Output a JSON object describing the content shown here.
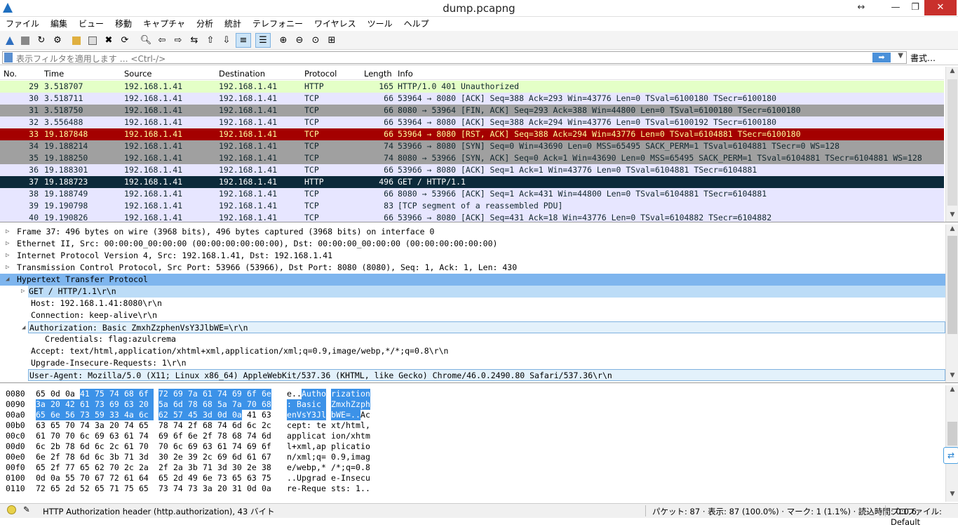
{
  "window": {
    "title": "dump.pcapng"
  },
  "menu": [
    "ファイル",
    "編集",
    "ビュー",
    "移動",
    "キャプチャ",
    "分析",
    "統計",
    "テレフォニー",
    "ワイヤレス",
    "ツール",
    "ヘルプ"
  ],
  "filter": {
    "placeholder": "表示フィルタを適用します … <Ctrl-/>",
    "format_label": "書式…"
  },
  "packet_list": {
    "columns": [
      "No.",
      "Time",
      "Source",
      "Destination",
      "Protocol",
      "Length",
      "Info"
    ],
    "rows": [
      {
        "no": "29",
        "time": "3.518707",
        "src": "192.168.1.41",
        "dst": "192.168.1.41",
        "proto": "HTTP",
        "len": "165",
        "info": "HTTP/1.0 401 Unauthorized",
        "bg": "#e4ffc7",
        "fg": "#12272e"
      },
      {
        "no": "30",
        "time": "3.518711",
        "src": "192.168.1.41",
        "dst": "192.168.1.41",
        "proto": "TCP",
        "len": "66",
        "info": "53964 → 8080 [ACK] Seq=388 Ack=293 Win=43776 Len=0 TSval=6100180 TSecr=6100180",
        "bg": "#e7e6ff",
        "fg": "#12272e"
      },
      {
        "no": "31",
        "time": "3.518750",
        "src": "192.168.1.41",
        "dst": "192.168.1.41",
        "proto": "TCP",
        "len": "66",
        "info": "8080 → 53964 [FIN, ACK] Seq=293 Ack=388 Win=44800 Len=0 TSval=6100180 TSecr=6100180",
        "bg": "#a0a0a0",
        "fg": "#12272e"
      },
      {
        "no": "32",
        "time": "3.556488",
        "src": "192.168.1.41",
        "dst": "192.168.1.41",
        "proto": "TCP",
        "len": "66",
        "info": "53964 → 8080 [ACK] Seq=388 Ack=294 Win=43776 Len=0 TSval=6100192 TSecr=6100180",
        "bg": "#e7e6ff",
        "fg": "#12272e"
      },
      {
        "no": "33",
        "time": "19.187848",
        "src": "192.168.1.41",
        "dst": "192.168.1.41",
        "proto": "TCP",
        "len": "66",
        "info": "53964 → 8080 [RST, ACK] Seq=388 Ack=294 Win=43776 Len=0 TSval=6104881 TSecr=6100180",
        "bg": "#a40000",
        "fg": "#fffc9c"
      },
      {
        "no": "34",
        "time": "19.188214",
        "src": "192.168.1.41",
        "dst": "192.168.1.41",
        "proto": "TCP",
        "len": "74",
        "info": "53966 → 8080 [SYN] Seq=0 Win=43690 Len=0 MSS=65495 SACK_PERM=1 TSval=6104881 TSecr=0 WS=128",
        "bg": "#a0a0a0",
        "fg": "#12272e"
      },
      {
        "no": "35",
        "time": "19.188250",
        "src": "192.168.1.41",
        "dst": "192.168.1.41",
        "proto": "TCP",
        "len": "74",
        "info": "8080 → 53966 [SYN, ACK] Seq=0 Ack=1 Win=43690 Len=0 MSS=65495 SACK_PERM=1 TSval=6104881 TSecr=6104881 WS=128",
        "bg": "#a0a0a0",
        "fg": "#12272e"
      },
      {
        "no": "36",
        "time": "19.188301",
        "src": "192.168.1.41",
        "dst": "192.168.1.41",
        "proto": "TCP",
        "len": "66",
        "info": "53966 → 8080 [ACK] Seq=1 Ack=1 Win=43776 Len=0 TSval=6104881 TSecr=6104881",
        "bg": "#e7e6ff",
        "fg": "#12272e"
      },
      {
        "no": "37",
        "time": "19.188723",
        "src": "192.168.1.41",
        "dst": "192.168.1.41",
        "proto": "HTTP",
        "len": "496",
        "info": "GET / HTTP/1.1",
        "bg": "#0c2a3a",
        "fg": "#ffffff"
      },
      {
        "no": "38",
        "time": "19.188749",
        "src": "192.168.1.41",
        "dst": "192.168.1.41",
        "proto": "TCP",
        "len": "66",
        "info": "8080 → 53966 [ACK] Seq=1 Ack=431 Win=44800 Len=0 TSval=6104881 TSecr=6104881",
        "bg": "#e7e6ff",
        "fg": "#12272e"
      },
      {
        "no": "39",
        "time": "19.190798",
        "src": "192.168.1.41",
        "dst": "192.168.1.41",
        "proto": "TCP",
        "len": "83",
        "info": "[TCP segment of a reassembled PDU]",
        "bg": "#e7e6ff",
        "fg": "#12272e"
      },
      {
        "no": "40",
        "time": "19.190826",
        "src": "192.168.1.41",
        "dst": "192.168.1.41",
        "proto": "TCP",
        "len": "66",
        "info": "53966 → 8080 [ACK] Seq=431 Ack=18 Win=43776 Len=0 TSval=6104882 TSecr=6104882",
        "bg": "#e7e6ff",
        "fg": "#12272e"
      }
    ]
  },
  "details": [
    {
      "indent": 0,
      "toggle": "▷",
      "text": "Frame 37: 496 bytes on wire (3968 bits), 496 bytes captured (3968 bits) on interface 0",
      "style": ""
    },
    {
      "indent": 0,
      "toggle": "▷",
      "text": "Ethernet II, Src: 00:00:00_00:00:00 (00:00:00:00:00:00), Dst: 00:00:00_00:00:00 (00:00:00:00:00:00)",
      "style": ""
    },
    {
      "indent": 0,
      "toggle": "▷",
      "text": "Internet Protocol Version 4, Src: 192.168.1.41, Dst: 192.168.1.41",
      "style": ""
    },
    {
      "indent": 0,
      "toggle": "▷",
      "text": "Transmission Control Protocol, Src Port: 53966 (53966), Dst Port: 8080 (8080), Seq: 1, Ack: 1, Len: 430",
      "style": ""
    },
    {
      "indent": 0,
      "toggle": "◢",
      "text": "Hypertext Transfer Protocol",
      "style": "sel"
    },
    {
      "indent": 1,
      "toggle": "▷",
      "text": "GET / HTTP/1.1\\r\\n",
      "style": "sub"
    },
    {
      "indent": 1,
      "toggle": "",
      "text": "Host: 192.168.1.41:8080\\r\\n",
      "style": ""
    },
    {
      "indent": 1,
      "toggle": "",
      "text": "Connection: keep-alive\\r\\n",
      "style": ""
    },
    {
      "indent": 1,
      "toggle": "◢",
      "text": "Authorization: Basic ZmxhZzphenVsY3JlbWE=\\r\\n",
      "style": "box"
    },
    {
      "indent": 2,
      "toggle": "",
      "text": "Credentials: flag:azulcrema",
      "style": ""
    },
    {
      "indent": 1,
      "toggle": "",
      "text": "Accept: text/html,application/xhtml+xml,application/xml;q=0.9,image/webp,*/*;q=0.8\\r\\n",
      "style": ""
    },
    {
      "indent": 1,
      "toggle": "",
      "text": "Upgrade-Insecure-Requests: 1\\r\\n",
      "style": ""
    },
    {
      "indent": 1,
      "toggle": "",
      "text": "User-Agent: Mozilla/5.0 (X11; Linux x86_64) AppleWebKit/537.36 (KHTML, like Gecko) Chrome/46.0.2490.80 Safari/537.36\\r\\n",
      "style": "box"
    }
  ],
  "bytes": [
    {
      "off": "0080",
      "hex": [
        "65",
        "0d",
        "0a",
        "41",
        "75",
        "74",
        "68",
        "6f",
        "72",
        "69",
        "7a",
        "61",
        "74",
        "69",
        "6f",
        "6e"
      ],
      "ascii": "e..Authorization",
      "hl_start": 3,
      "hl_end": 16
    },
    {
      "off": "0090",
      "hex": [
        "3a",
        "20",
        "42",
        "61",
        "73",
        "69",
        "63",
        "20",
        "5a",
        "6d",
        "78",
        "68",
        "5a",
        "7a",
        "70",
        "68"
      ],
      "ascii": ": Basic ZmxhZzph",
      "hl_start": 0,
      "hl_end": 16
    },
    {
      "off": "00a0",
      "hex": [
        "65",
        "6e",
        "56",
        "73",
        "59",
        "33",
        "4a",
        "6c",
        "62",
        "57",
        "45",
        "3d",
        "0d",
        "0a",
        "41",
        "63"
      ],
      "ascii": "enVsY3JlbWE=..Ac",
      "hl_start": 0,
      "hl_end": 14
    },
    {
      "off": "00b0",
      "hex": [
        "63",
        "65",
        "70",
        "74",
        "3a",
        "20",
        "74",
        "65",
        "78",
        "74",
        "2f",
        "68",
        "74",
        "6d",
        "6c",
        "2c"
      ],
      "ascii": "cept: text/html,",
      "hl_start": 0,
      "hl_end": 0
    },
    {
      "off": "00c0",
      "hex": [
        "61",
        "70",
        "70",
        "6c",
        "69",
        "63",
        "61",
        "74",
        "69",
        "6f",
        "6e",
        "2f",
        "78",
        "68",
        "74",
        "6d"
      ],
      "ascii": "application/xhtm",
      "hl_start": 0,
      "hl_end": 0
    },
    {
      "off": "00d0",
      "hex": [
        "6c",
        "2b",
        "78",
        "6d",
        "6c",
        "2c",
        "61",
        "70",
        "70",
        "6c",
        "69",
        "63",
        "61",
        "74",
        "69",
        "6f"
      ],
      "ascii": "l+xml,application",
      "hl_start": 0,
      "hl_end": 0
    },
    {
      "off": "00e0",
      "hex": [
        "6e",
        "2f",
        "78",
        "6d",
        "6c",
        "3b",
        "71",
        "3d",
        "30",
        "2e",
        "39",
        "2c",
        "69",
        "6d",
        "61",
        "67"
      ],
      "ascii": "n/xml;q=0.9,imag",
      "hl_start": 0,
      "hl_end": 0
    },
    {
      "off": "00f0",
      "hex": [
        "65",
        "2f",
        "77",
        "65",
        "62",
        "70",
        "2c",
        "2a",
        "2f",
        "2a",
        "3b",
        "71",
        "3d",
        "30",
        "2e",
        "38"
      ],
      "ascii": "e/webp,*/*;q=0.8",
      "hl_start": 0,
      "hl_end": 0
    },
    {
      "off": "0100",
      "hex": [
        "0d",
        "0a",
        "55",
        "70",
        "67",
        "72",
        "61",
        "64",
        "65",
        "2d",
        "49",
        "6e",
        "73",
        "65",
        "63",
        "75"
      ],
      "ascii": "..Upgrade-Insecu",
      "hl_start": 0,
      "hl_end": 0
    },
    {
      "off": "0110",
      "hex": [
        "72",
        "65",
        "2d",
        "52",
        "65",
        "71",
        "75",
        "65",
        "73",
        "74",
        "73",
        "3a",
        "20",
        "31",
        "0d",
        "0a"
      ],
      "ascii": "re-Requests: 1..",
      "hl_start": 0,
      "hl_end": 0
    }
  ],
  "status": {
    "field": "HTTP Authorization header (http.authorization), 43 バイト",
    "packets": "パケット: 87 · 表示: 87 (100.0%) · マーク: 1 (1.1%) · 読込時間: 0:0.6",
    "profile": "プロファイル: Default"
  },
  "colors": {
    "selected_tree": "#7eb5ee",
    "hex_highlight": "#3c92e8",
    "close_button": "#c9302c"
  }
}
